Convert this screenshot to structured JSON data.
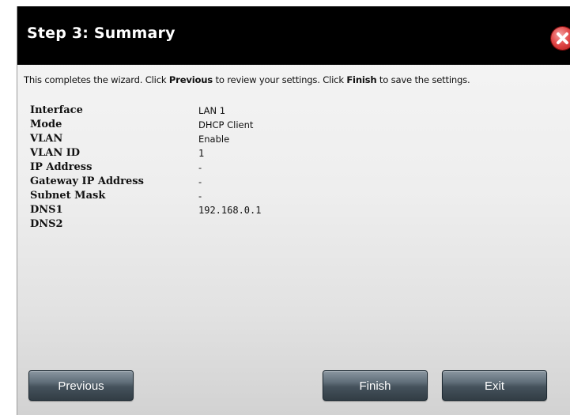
{
  "dialog": {
    "title": "Step 3: Summary",
    "intro": {
      "part1": "This completes the wizard. Click ",
      "previous_word": "Previous",
      "part2": " to review your settings. Click ",
      "finish_word": "Finish",
      "part3": " to save the settings."
    },
    "rows": [
      {
        "label": "Interface",
        "value": "LAN 1"
      },
      {
        "label": "Mode",
        "value": "DHCP Client"
      },
      {
        "label": "VLAN",
        "value": "Enable"
      },
      {
        "label": "VLAN ID",
        "value": "1"
      },
      {
        "label": "IP Address",
        "value": "-"
      },
      {
        "label": "Gateway IP Address",
        "value": "-"
      },
      {
        "label": "Subnet Mask",
        "value": "-"
      },
      {
        "label": "DNS1",
        "value": "192.168.0.1"
      },
      {
        "label": "DNS2",
        "value": ""
      }
    ],
    "buttons": {
      "previous": "Previous",
      "finish": "Finish",
      "exit": "Exit"
    },
    "colors": {
      "titlebar": "#000000",
      "close": "#d63030",
      "button": "#4a5760"
    },
    "icons": {
      "close": "close-icon"
    }
  }
}
